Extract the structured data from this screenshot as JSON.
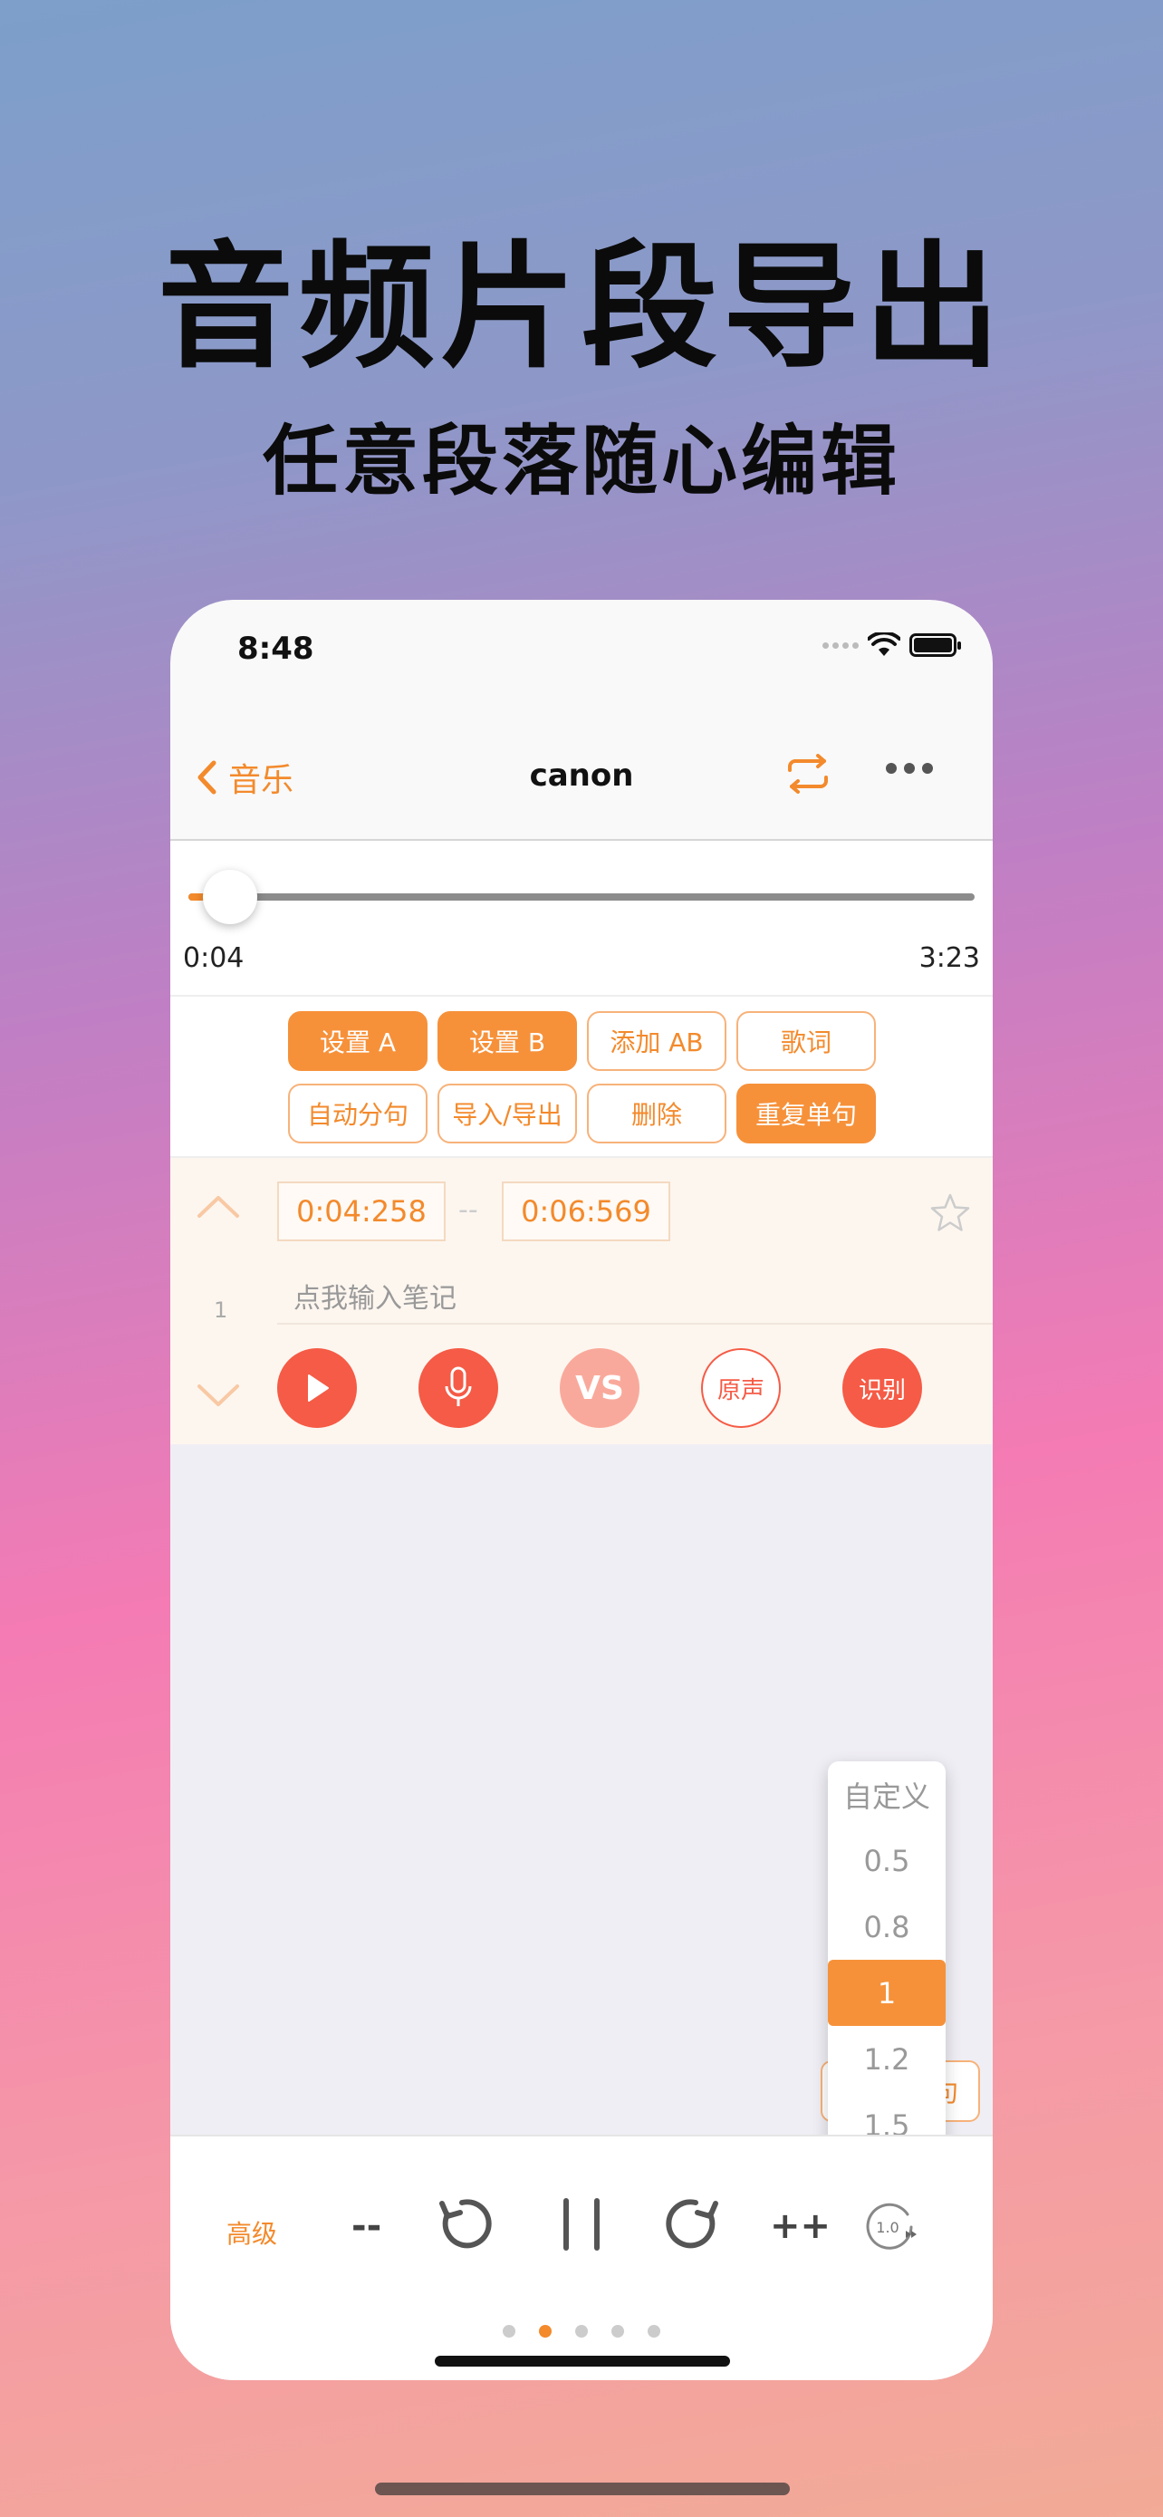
{
  "promo": {
    "headline": "音频片段导出",
    "subline": "任意段落随心编辑"
  },
  "status_bar": {
    "time": "8:48"
  },
  "nav": {
    "back_label": "音乐",
    "title": "canon"
  },
  "player": {
    "current_time": "0:04",
    "total_time": "3:23",
    "progress_fraction": 0.02
  },
  "actions": [
    {
      "label": "设置 A",
      "filled": true
    },
    {
      "label": "设置 B",
      "filled": true
    },
    {
      "label": "添加 AB",
      "filled": false
    },
    {
      "label": "歌词",
      "filled": false
    },
    {
      "label": "自动分句",
      "filled": false
    },
    {
      "label": "导入/导出",
      "filled": false
    },
    {
      "label": "删除",
      "filled": false
    },
    {
      "label": "重复单句",
      "filled": true
    }
  ],
  "clip": {
    "index": "1",
    "start": "0:04:258",
    "separator": "--",
    "end": "0:06:569",
    "note_placeholder": "点我输入笔记",
    "vs_label": "VS",
    "original_label": "原声",
    "recognize_label": "识别"
  },
  "speed_menu": {
    "options": [
      "自定义",
      "0.5",
      "0.8",
      "1",
      "1.2",
      "1.5"
    ],
    "selected": "1"
  },
  "hidden_button_fragment": "句",
  "bottom": {
    "advanced_label": "高级",
    "minus_label": "--",
    "plus_label": "++",
    "speed_badge": "1.0"
  },
  "colors": {
    "accent": "#f38a2c",
    "record_red": "#f55b46"
  }
}
